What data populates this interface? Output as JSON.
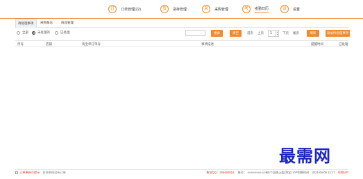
{
  "nav": {
    "items": [
      {
        "icon": "订",
        "label": "订单管理(22)",
        "active": false
      },
      {
        "icon": "货",
        "label": "货存管理",
        "active": false
      },
      {
        "icon": "采",
        "label": "采购管理",
        "active": false
      },
      {
        "icon": "考",
        "label": "考勤日历",
        "active": true
      },
      {
        "icon": "设",
        "label": "设置",
        "active": false
      }
    ]
  },
  "subtabs": [
    "待处理事项",
    "采购备忘",
    "商品管理"
  ],
  "toolbar": {
    "radios": [
      "全部",
      "未处理的",
      "已处理"
    ],
    "search_button": "搜索",
    "reset_button": "清空",
    "first_page": "首页",
    "prev_page": "上页",
    "page_number": "1",
    "next_page": "下页",
    "last_page": "尾页",
    "refresh_button": "刷新",
    "add_button": "添加待处理事项"
  },
  "table": {
    "headers": [
      "序号",
      "店铺",
      "淘宝单订单号",
      "事项描述",
      "提醒时间",
      "已处理"
    ]
  },
  "watermark": "最需网",
  "status": {
    "left_red": "订单更新可提示",
    "left_gray": "目前系统没有订单",
    "qq": "售前QQ：259460918",
    "account": "账号：",
    "account_masked": "■■■■■■■■",
    "mid_text": "已有5个店铺上架(淘宝) VIP到期时间：2021-09-09 12:17",
    "renew": "续期VIP"
  }
}
